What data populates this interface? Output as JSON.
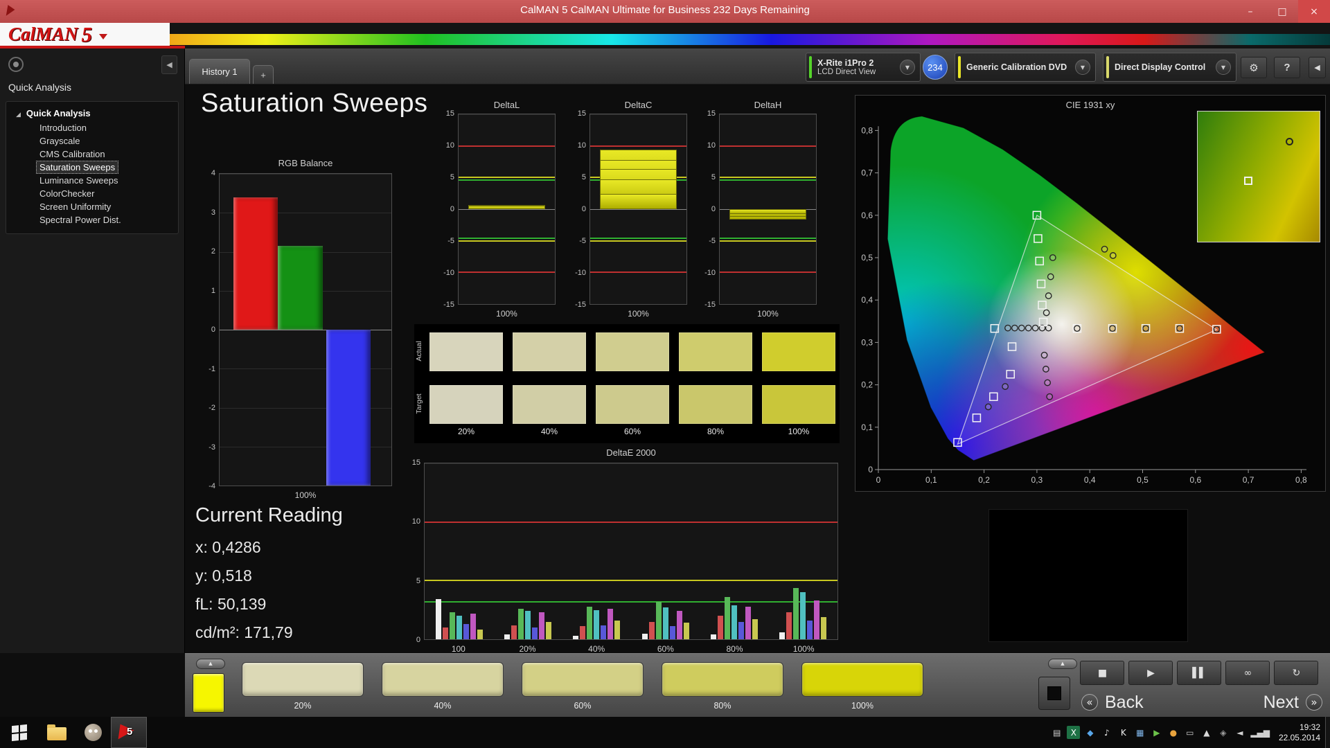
{
  "window": {
    "title": "CalMAN 5 CalMAN Ultimate for Business 232 Days Remaining",
    "minimize_glyph": "–",
    "maximize_glyph": "□",
    "close_glyph": "×"
  },
  "brand": {
    "name": "CalMAN",
    "version": "5"
  },
  "sidebar": {
    "header": "Quick Analysis",
    "root_label": "Quick Analysis",
    "root_expander": "◢",
    "collapse_glyph": "◀",
    "items": [
      {
        "label": "Introduction",
        "selected": false
      },
      {
        "label": "Grayscale",
        "selected": false
      },
      {
        "label": "CMS Calibration",
        "selected": false
      },
      {
        "label": "Saturation Sweeps",
        "selected": true
      },
      {
        "label": "Luminance Sweeps",
        "selected": false
      },
      {
        "label": "ColorChecker",
        "selected": false
      },
      {
        "label": "Screen Uniformity",
        "selected": false
      },
      {
        "label": "Spectral Power Dist.",
        "selected": false
      }
    ]
  },
  "toolbar": {
    "history_tab": "History 1",
    "add_tab": "+",
    "meter_line1": "X-Rite i1Pro 2",
    "meter_line2": "LCD Direct View",
    "meter_accent": "#55d42a",
    "badge": "234",
    "source_label": "Generic Calibration DVD",
    "source_accent": "#e8e428",
    "display_label": "Direct Display Control",
    "display_accent": "#d8d86a",
    "dropdown_glyph": "▼",
    "gear_glyph": "⚙",
    "help_glyph": "?",
    "collapse_glyph": "◀"
  },
  "page": {
    "title": "Saturation Sweeps"
  },
  "current_reading": {
    "heading": "Current Reading",
    "lines": [
      "x: 0,4286",
      "y: 0,518",
      "fL: 50,139",
      "cd/m²: 171,79"
    ]
  },
  "swatch_table": {
    "row_labels": [
      "Actual",
      "Target"
    ],
    "col_labels": [
      "20%",
      "40%",
      "60%",
      "80%",
      "100%"
    ],
    "actual_colors": [
      "#d8d5bc",
      "#d4d0a8",
      "#d0cd8f",
      "#cfcc6d",
      "#d0cd2d"
    ],
    "target_colors": [
      "#d6d3bc",
      "#d1cea6",
      "#cdca8d",
      "#cac76b",
      "#c9c63a"
    ]
  },
  "chart_data": [
    {
      "id": "rgb_balance",
      "type": "bar",
      "title": "RGB Balance",
      "categories": [
        "Red",
        "Green",
        "Blue"
      ],
      "values": [
        3.4,
        2.15,
        -4.0
      ],
      "bar_colors": [
        "#e01818",
        "#149114",
        "#3434ee"
      ],
      "ylim": [
        -4,
        4
      ],
      "yticks": [
        4,
        3,
        2,
        1,
        0,
        -1,
        -2,
        -3,
        -4
      ],
      "xlabel": "100%"
    },
    {
      "id": "deltaL",
      "type": "bar",
      "title": "DeltaL",
      "values": [
        0.7,
        0.5
      ],
      "ylim": [
        -15,
        15
      ],
      "yticks": [
        15,
        10,
        5,
        0,
        -5,
        -10,
        -15
      ],
      "limit_lines": [
        {
          "value": 10,
          "color": "#c03030"
        },
        {
          "value": -10,
          "color": "#c03030"
        },
        {
          "value": 5,
          "color": "#c8c820"
        },
        {
          "value": -5,
          "color": "#c8c820"
        },
        {
          "value": 4.6,
          "color": "#30b030"
        },
        {
          "value": -4.6,
          "color": "#30b030"
        }
      ],
      "xlabel": "100%"
    },
    {
      "id": "deltaC",
      "type": "bar",
      "title": "DeltaC",
      "values": [
        9.4,
        7.8,
        6.3,
        4.7,
        2.4
      ],
      "ylim": [
        -15,
        15
      ],
      "yticks": [
        15,
        10,
        5,
        0,
        -5,
        -10,
        -15
      ],
      "limit_lines": [
        {
          "value": 10,
          "color": "#c03030"
        },
        {
          "value": -10,
          "color": "#c03030"
        },
        {
          "value": 5,
          "color": "#c8c820"
        },
        {
          "value": -5,
          "color": "#c8c820"
        },
        {
          "value": 4.6,
          "color": "#30b030"
        },
        {
          "value": -4.6,
          "color": "#30b030"
        }
      ],
      "xlabel": "100%"
    },
    {
      "id": "deltaH",
      "type": "bar",
      "title": "DeltaH",
      "values": [
        -1.6,
        -1.2,
        -0.8
      ],
      "ylim": [
        -15,
        15
      ],
      "yticks": [
        15,
        10,
        5,
        0,
        -5,
        -10,
        -15
      ],
      "limit_lines": [
        {
          "value": 10,
          "color": "#c03030"
        },
        {
          "value": -10,
          "color": "#c03030"
        },
        {
          "value": 5,
          "color": "#c8c820"
        },
        {
          "value": -5,
          "color": "#c8c820"
        },
        {
          "value": 4.6,
          "color": "#30b030"
        },
        {
          "value": -4.6,
          "color": "#30b030"
        }
      ],
      "xlabel": "100%"
    },
    {
      "id": "deltaE2000",
      "type": "grouped-bar",
      "title": "DeltaE 2000",
      "ylim": [
        0,
        15
      ],
      "yticks": [
        15,
        10,
        5,
        0
      ],
      "categories": [
        "100",
        "20%",
        "40%",
        "60%",
        "80%",
        "100%"
      ],
      "series_colors": [
        "#f0f0f0",
        "#d05050",
        "#58b858",
        "#50c0c0",
        "#5858d8",
        "#c058c0",
        "#c8c850"
      ],
      "groups": [
        [
          3.4,
          1.0,
          2.3,
          2.0,
          1.3,
          2.2,
          0.8
        ],
        [
          0.4,
          1.2,
          2.6,
          2.4,
          1.0,
          2.3,
          1.5
        ],
        [
          0.3,
          1.1,
          2.8,
          2.5,
          1.2,
          2.6,
          1.6
        ],
        [
          0.5,
          1.5,
          3.2,
          2.7,
          1.1,
          2.4,
          1.4
        ],
        [
          0.4,
          2.0,
          3.6,
          2.9,
          1.5,
          2.8,
          1.7
        ],
        [
          0.6,
          2.3,
          4.4,
          4.0,
          1.6,
          3.3,
          1.9
        ]
      ],
      "limit_lines": [
        {
          "value": 10,
          "color": "#c03030"
        },
        {
          "value": 5,
          "color": "#c8c820"
        },
        {
          "value": 3.2,
          "color": "#30b030"
        }
      ]
    },
    {
      "id": "cie",
      "type": "scatter",
      "title": "CIE 1931 xy",
      "xlim": [
        0,
        0.8
      ],
      "ylim": [
        0,
        0.8
      ],
      "xticks": [
        "0",
        "0,1",
        "0,2",
        "0,3",
        "0,4",
        "0,5",
        "0,6",
        "0,7",
        "0,8"
      ],
      "yticks": [
        "0",
        "0,1",
        "0,2",
        "0,3",
        "0,4",
        "0,5",
        "0,6",
        "0,7",
        "0,8"
      ],
      "gamut_triangle": [
        [
          0.64,
          0.33
        ],
        [
          0.3,
          0.6
        ],
        [
          0.15,
          0.06
        ]
      ],
      "target_squares": [
        [
          0.3,
          0.6
        ],
        [
          0.302,
          0.545
        ],
        [
          0.305,
          0.492
        ],
        [
          0.308,
          0.438
        ],
        [
          0.31,
          0.388
        ],
        [
          0.312,
          0.348
        ],
        [
          0.22,
          0.333
        ],
        [
          0.376,
          0.333
        ],
        [
          0.443,
          0.333
        ],
        [
          0.506,
          0.333
        ],
        [
          0.57,
          0.333
        ],
        [
          0.64,
          0.331
        ],
        [
          0.253,
          0.29
        ],
        [
          0.25,
          0.225
        ],
        [
          0.218,
          0.172
        ],
        [
          0.186,
          0.122
        ],
        [
          0.15,
          0.064
        ]
      ],
      "measured_circles": [
        [
          0.245,
          0.334
        ],
        [
          0.258,
          0.334
        ],
        [
          0.271,
          0.334
        ],
        [
          0.284,
          0.334
        ],
        [
          0.297,
          0.334
        ],
        [
          0.31,
          0.334
        ],
        [
          0.322,
          0.334
        ],
        [
          0.376,
          0.333
        ],
        [
          0.443,
          0.333
        ],
        [
          0.506,
          0.333
        ],
        [
          0.57,
          0.333
        ],
        [
          0.64,
          0.331
        ],
        [
          0.33,
          0.5
        ],
        [
          0.326,
          0.455
        ],
        [
          0.322,
          0.41
        ],
        [
          0.318,
          0.37
        ],
        [
          0.428,
          0.52
        ],
        [
          0.444,
          0.505
        ],
        [
          0.314,
          0.27
        ],
        [
          0.317,
          0.237
        ],
        [
          0.32,
          0.205
        ],
        [
          0.324,
          0.172
        ],
        [
          0.24,
          0.196
        ],
        [
          0.208,
          0.148
        ]
      ]
    }
  ],
  "bottom": {
    "up_arrow": "▲",
    "mini_swatch_color": "#f6f600",
    "swatches": [
      {
        "label": "20%",
        "color": "#dcd9b6"
      },
      {
        "label": "40%",
        "color": "#d7d4a0"
      },
      {
        "label": "60%",
        "color": "#d3d086"
      },
      {
        "label": "80%",
        "color": "#cfcc5e"
      },
      {
        "label": "100%",
        "color": "#d8d508"
      }
    ],
    "transport": [
      {
        "name": "stop",
        "glyph": "■"
      },
      {
        "name": "play",
        "glyph": "▶"
      },
      {
        "name": "pause",
        "glyph": "▌▌"
      },
      {
        "name": "loop",
        "glyph": "∞"
      },
      {
        "name": "continuous",
        "glyph": "↻"
      }
    ],
    "back_chevron": "«",
    "back_label": "Back",
    "next_label": "Next",
    "next_chevron": "»"
  },
  "taskbar": {
    "calman_badge": "5",
    "clock_time": "19:32",
    "clock_date": "22.05.2014",
    "tray": [
      {
        "name": "tray-tablet-icon",
        "glyph": "▤",
        "color": "#cfcfcf"
      },
      {
        "name": "tray-excel-icon",
        "glyph": "X",
        "color": "#ffffff",
        "bg": "#1e7145"
      },
      {
        "name": "tray-sync-icon",
        "glyph": "◆",
        "color": "#58a6e8"
      },
      {
        "name": "tray-volume-icon",
        "glyph": "♪",
        "color": "#e0e0e0"
      },
      {
        "name": "tray-k-icon",
        "glyph": "K",
        "color": "#f0f0f0"
      },
      {
        "name": "tray-calendar-icon",
        "glyph": "▦",
        "color": "#7fb4e8"
      },
      {
        "name": "tray-player-icon",
        "glyph": "▶",
        "color": "#6cc24a"
      },
      {
        "name": "tray-update-icon",
        "glyph": "●",
        "color": "#e8a33d"
      },
      {
        "name": "tray-display-icon",
        "glyph": "▭",
        "color": "#c8c8c8"
      },
      {
        "name": "tray-vpn-icon",
        "glyph": "▲",
        "color": "#d8d8d8"
      },
      {
        "name": "tray-usb-icon",
        "glyph": "◈",
        "color": "#9e9e9e"
      },
      {
        "name": "tray-audio-icon",
        "glyph": "◄",
        "color": "#d0d0d0"
      },
      {
        "name": "tray-network-icon",
        "glyph": "▂▄▆",
        "color": "#d0d0d0"
      }
    ]
  }
}
